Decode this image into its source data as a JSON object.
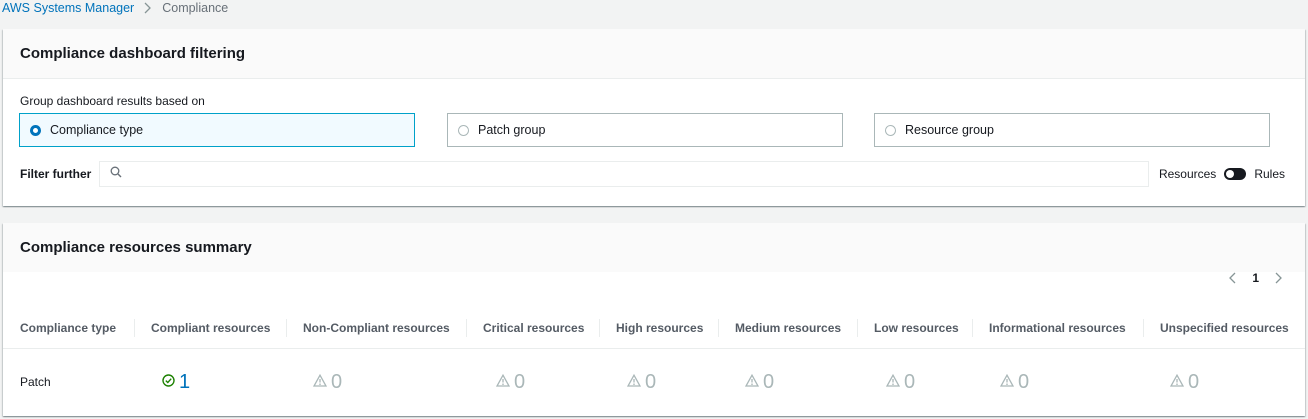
{
  "breadcrumb": {
    "root": "AWS Systems Manager",
    "current": "Compliance"
  },
  "filtering": {
    "title": "Compliance dashboard filtering",
    "group_label": "Group dashboard results based on",
    "options": [
      {
        "label": "Compliance type",
        "selected": true
      },
      {
        "label": "Patch group",
        "selected": false
      },
      {
        "label": "Resource group",
        "selected": false
      }
    ],
    "filter_label": "Filter further",
    "search_placeholder": "",
    "toggle_left": "Resources",
    "toggle_right": "Rules"
  },
  "summary": {
    "title": "Compliance resources summary",
    "page": "1",
    "columns": [
      "Compliance type",
      "Compliant resources",
      "Non-Compliant resources",
      "Critical resources",
      "High resources",
      "Medium resources",
      "Low resources",
      "Informational resources",
      "Unspecified resources"
    ],
    "rows": [
      {
        "type": "Patch",
        "compliant": "1",
        "non_compliant": "0",
        "critical": "0",
        "high": "0",
        "medium": "0",
        "low": "0",
        "informational": "0",
        "unspecified": "0"
      }
    ]
  },
  "colors": {
    "link": "#0073bb",
    "selected_border": "#00a1c9",
    "ok": "#1d8102",
    "muted": "#aab7b8"
  },
  "icons": [
    "chevron-right-icon",
    "search-icon",
    "check-circle-icon",
    "warning-icon",
    "chevron-left-icon"
  ]
}
